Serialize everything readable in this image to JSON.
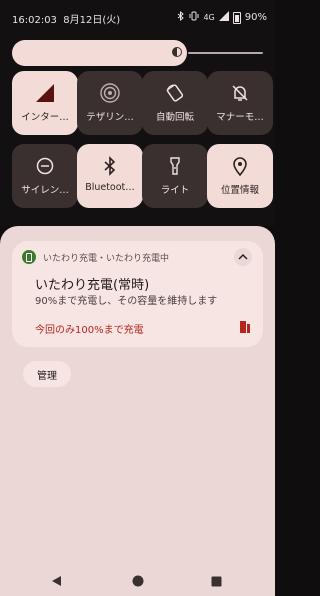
{
  "status_bar": {
    "time": "16:02:03",
    "date": "8月12日(火)",
    "network": "4G",
    "battery": "90%"
  },
  "brightness": {
    "level": 0.62
  },
  "tiles": [
    {
      "label": "インター…",
      "icon": "signal-icon",
      "state": "on"
    },
    {
      "label": "テザリン…",
      "icon": "hotspot-icon",
      "state": "off"
    },
    {
      "label": "自動回転",
      "icon": "auto-rotate-icon",
      "state": "off"
    },
    {
      "label": "マナーモ…",
      "icon": "bell-off-icon",
      "state": "off"
    },
    {
      "label": "サイレン…",
      "icon": "do-not-disturb-icon",
      "state": "off"
    },
    {
      "label": "Bluetoot…",
      "icon": "bluetooth-icon",
      "state": "on"
    },
    {
      "label": "ライト",
      "icon": "flashlight-icon",
      "state": "off"
    },
    {
      "label": "位置情報",
      "icon": "location-icon",
      "state": "on"
    }
  ],
  "notification": {
    "app_line": "いたわり充電・いたわり充電中",
    "title": "いたわり充電(常時)",
    "body": "90%まで充電し、その容量を維持します",
    "action": "今回のみ100%まで充電"
  },
  "manage_button": "管理",
  "colors": {
    "accent": "#b3261e",
    "tile_on": "#f3dcd8",
    "tile_off": "#3a302f",
    "panel": "#ead7d6"
  }
}
